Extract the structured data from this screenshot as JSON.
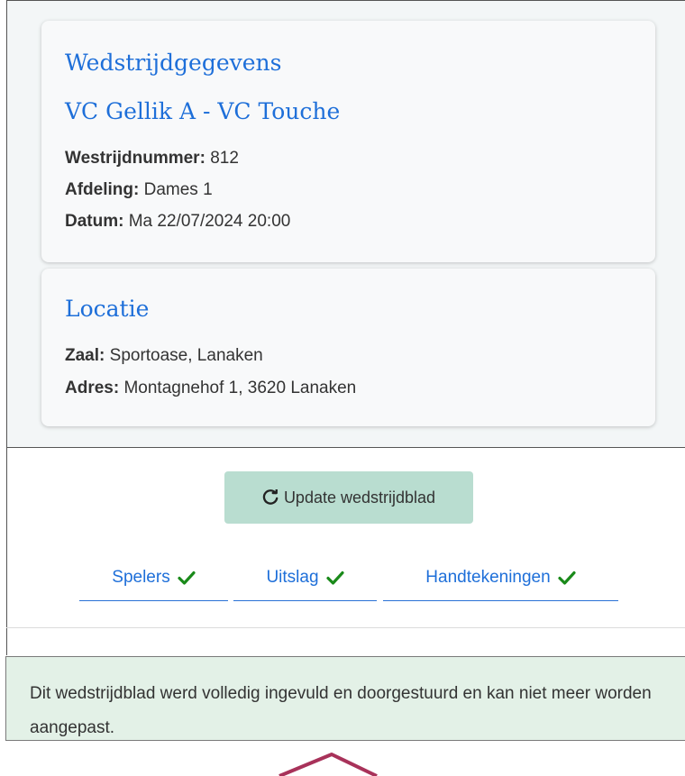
{
  "match_card": {
    "heading": "Wedstrijdgegevens",
    "teams": "VC Gellik A - VC Touche",
    "fields": [
      {
        "label": "Westrijdnummer:",
        "value": "812"
      },
      {
        "label": "Afdeling:",
        "value": "Dames 1"
      },
      {
        "label": "Datum:",
        "value": "Ma 22/07/2024 20:00"
      }
    ]
  },
  "location_card": {
    "heading": "Locatie",
    "fields": [
      {
        "label": "Zaal:",
        "value": "Sportoase, Lanaken"
      },
      {
        "label": "Adres:",
        "value": "Montagnehof 1, 3620 Lanaken"
      }
    ]
  },
  "actions": {
    "update_label": "Update wedstrijdblad",
    "update_icon": "refresh-icon"
  },
  "tabs": [
    {
      "label": "Spelers",
      "status_icon": "check-icon"
    },
    {
      "label": "Uitslag",
      "status_icon": "check-icon"
    },
    {
      "label": "Handtekeningen",
      "status_icon": "check-icon"
    }
  ],
  "alert": {
    "message": "Dit wedstrijdblad werd volledig ingevuld en doorgestuurd en kan niet meer worden aangepast."
  },
  "colors": {
    "link_blue": "#1e6fd9",
    "button_bg": "#b9ddd0",
    "alert_bg": "#e3f1e7",
    "check_green": "#1a8a1a",
    "pointer_red": "#a8325a"
  }
}
